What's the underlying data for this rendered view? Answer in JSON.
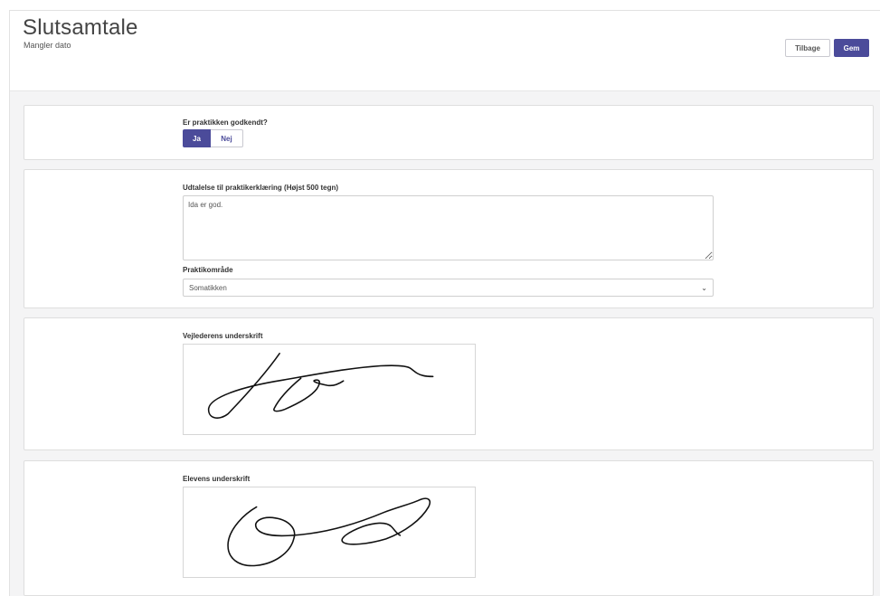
{
  "header": {
    "title": "Slutsamtale",
    "subtitle": "Mangler dato",
    "back_label": "Tilbage",
    "save_label": "Gem"
  },
  "approval": {
    "question": "Er praktikken godkendt?",
    "yes_label": "Ja",
    "no_label": "Nej",
    "selected": "Ja"
  },
  "statement": {
    "label": "Udtalelse til praktikerklæring (Højst 500 tegn)",
    "value": "Ida er god."
  },
  "practice_area": {
    "label": "Praktikområde",
    "selected": "Somatikken"
  },
  "supervisor_signature": {
    "label": "Vejlederens underskrift"
  },
  "student_signature": {
    "label": "Elevens underskrift"
  },
  "colors": {
    "accent": "#4b4b9a",
    "background": "#f4f4f5"
  }
}
